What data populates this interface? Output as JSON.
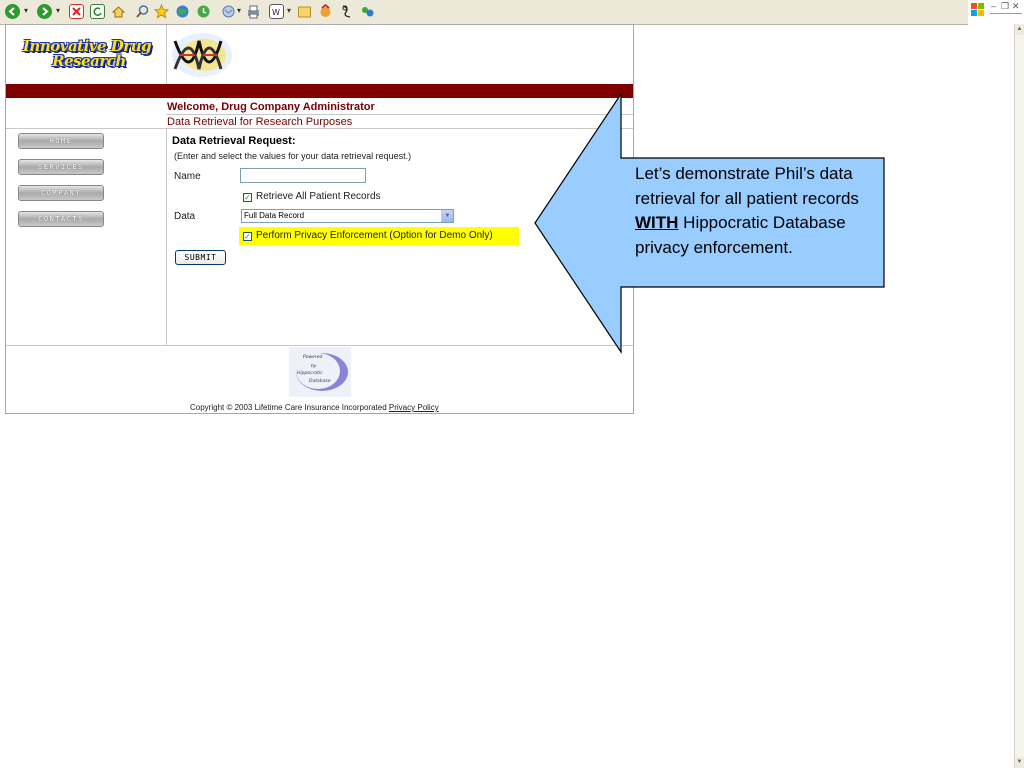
{
  "browser": {
    "toolbar_icons": [
      "back-icon",
      "forward-icon",
      "stop-icon",
      "refresh-icon",
      "home-icon",
      "search-icon",
      "favorites-icon",
      "media-icon",
      "history-icon",
      "mail-icon",
      "print-icon",
      "edit-icon",
      "discuss-icon",
      "messenger-icon",
      "research-icon",
      "extra-icon"
    ],
    "window_controls": {
      "minimize": "–",
      "restore": "❐",
      "close": "✕"
    }
  },
  "site": {
    "logo_line1": "Innovative Drug",
    "logo_line2": "Research",
    "welcome": "Welcome, Drug Company Administrator",
    "subtitle": "Data Retrieval for Research Purposes"
  },
  "nav": {
    "items": [
      {
        "label": "HOME"
      },
      {
        "label": "SERVICES"
      },
      {
        "label": "COMPANY"
      },
      {
        "label": "CONTACTS"
      }
    ]
  },
  "form": {
    "title": "Data Retrieval Request:",
    "hint": "(Enter and select the values for your data retrieval request.)",
    "name_label": "Name",
    "name_value": "",
    "retrieve_all_label": "Retrieve All Patient Records",
    "retrieve_all_checked": true,
    "data_label": "Data",
    "data_selected": "Full Data Record",
    "privacy_label": "Perform Privacy Enforcement (Option for Demo Only)",
    "privacy_checked": true,
    "submit_label": "SUBMIT"
  },
  "footer": {
    "copyright": "Copyright © 2003 Lifetime Care Insurance Incorporated",
    "privacy_link": "Privacy Policy",
    "seal_line1": "Powered",
    "seal_line2": "by",
    "seal_line3": "Hippocratic",
    "seal_line4": "Database"
  },
  "callout": {
    "text_before": "Let’s demonstrate Phil’s data retrieval for all patient records",
    "emphasis": "WITH",
    "text_after": "Hippocratic Database privacy enforcement.",
    "fill_color": "#99ccff",
    "border_color": "#000000"
  },
  "colors": {
    "brand_red": "#800000",
    "highlight": "#ffff00"
  }
}
